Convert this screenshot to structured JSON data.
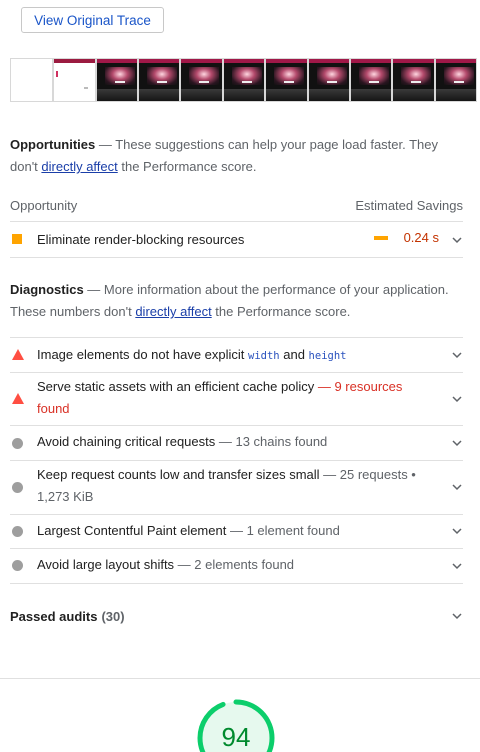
{
  "toolbar": {
    "trace_button_label": "View Original Trace"
  },
  "opportunities": {
    "title": "Opportunities",
    "desc_before": " — These suggestions can help your page load faster. They don't ",
    "link": "directly affect",
    "desc_after": " the Performance score.",
    "header_left": "Opportunity",
    "header_right": "Estimated Savings",
    "items": [
      {
        "label": "Eliminate render-blocking resources",
        "savings": "0.24 s",
        "status": "average",
        "status_color": "#ffa400"
      }
    ]
  },
  "diagnostics": {
    "title": "Diagnostics",
    "desc_before": " — More information about the performance of your application. These numbers don't ",
    "link": "directly affect",
    "desc_after": " the Performance score.",
    "items": [
      {
        "label_before": "Image elements do not have explicit ",
        "code1": "width",
        "label_mid": " and ",
        "code2": "height",
        "status": "fail"
      },
      {
        "label": "Serve static assets with an efficient cache policy",
        "detail": "9 resources found",
        "status": "fail"
      },
      {
        "label": "Avoid chaining critical requests",
        "detail": "13 chains found",
        "status": "info"
      },
      {
        "label": "Keep request counts low and transfer sizes small",
        "detail": "25 requests • 1,273 KiB",
        "status": "info"
      },
      {
        "label": "Largest Contentful Paint element",
        "detail": "1 element found",
        "status": "info"
      },
      {
        "label": "Avoid large layout shifts",
        "detail": "2 elements found",
        "status": "info"
      }
    ]
  },
  "passed": {
    "label": "Passed audits",
    "count": "(30)"
  },
  "score": {
    "value": "94",
    "color": "#0cce6b"
  },
  "icons": {
    "chevron": "chevron-down-icon",
    "square": "average-square-icon",
    "triangle": "fail-triangle-icon",
    "circle": "info-circle-icon"
  }
}
